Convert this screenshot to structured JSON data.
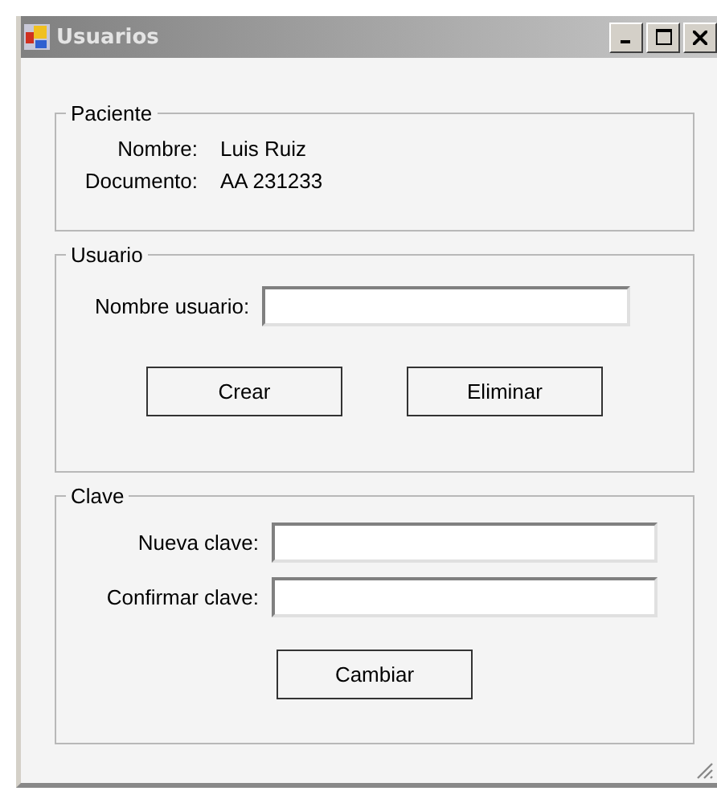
{
  "window": {
    "title": "Usuarios"
  },
  "paciente": {
    "legend": "Paciente",
    "rows": [
      {
        "label": "Nombre:",
        "value": "Luis Ruiz"
      },
      {
        "label": "Documento:",
        "value": "AA 231233"
      }
    ]
  },
  "usuario": {
    "legend": "Usuario",
    "field_label": "Nombre usuario:",
    "buttons": [
      "Crear",
      "Eliminar"
    ]
  },
  "clave": {
    "legend": "Clave",
    "fields": [
      {
        "label": "Nueva clave:"
      },
      {
        "label": "Confirmar clave:"
      }
    ],
    "button": "Cambiar"
  }
}
